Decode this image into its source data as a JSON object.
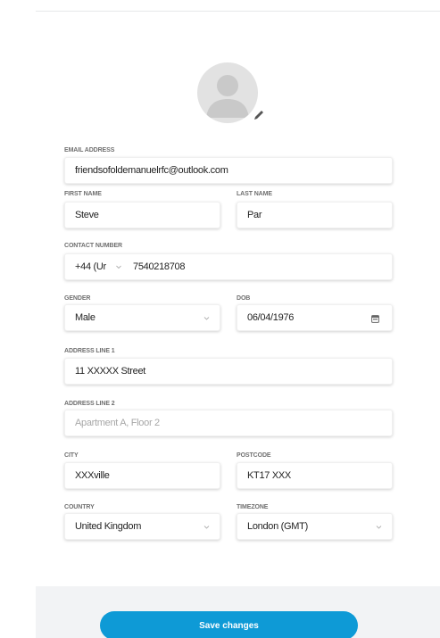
{
  "profile": {
    "avatar_icon": "default-user-avatar",
    "edit_icon": "pencil-icon"
  },
  "form": {
    "email": {
      "label": "EMAIL ADDRESS",
      "value": "friendsofoldemanuelrfc@outlook.com"
    },
    "first_name": {
      "label": "FIRST NAME",
      "value": "Steve"
    },
    "last_name": {
      "label": "LAST NAME",
      "value": "Par"
    },
    "contact_number": {
      "label": "CONTACT NUMBER",
      "code": "+44 (Ur",
      "number": "7540218708"
    },
    "gender": {
      "label": "GENDER",
      "value": "Male"
    },
    "dob": {
      "label": "DOB",
      "value": "06/04/1976"
    },
    "address_line_1": {
      "label": "ADDRESS LINE 1",
      "value": "11 XXXXX Street"
    },
    "address_line_2": {
      "label": "ADDRESS LINE 2",
      "placeholder": "Apartment A, Floor 2"
    },
    "city": {
      "label": "CITY",
      "value": "XXXville"
    },
    "postcode": {
      "label": "POSTCODE",
      "value": "KT17 XXX"
    },
    "country": {
      "label": "COUNTRY",
      "value": "United Kingdom"
    },
    "timezone": {
      "label": "TIMEZONE",
      "value": "London (GMT)"
    }
  },
  "footer": {
    "save_label": "Save changes"
  },
  "colors": {
    "accent": "#0e9ad6",
    "footer_bg": "#f2f3f5",
    "avatar_bg": "#e2e2e2"
  }
}
